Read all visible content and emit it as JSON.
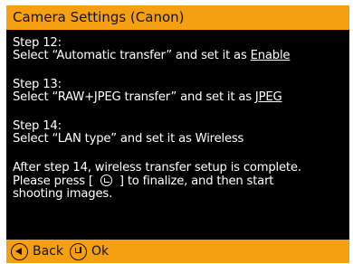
{
  "window": {
    "title": "Camera Settings (Canon)"
  },
  "steps": [
    {
      "heading": "Step 12:",
      "instruction_prefix": "Select “Automatic transfer” and set it as ",
      "value": "Enable"
    },
    {
      "heading": "Step 13:",
      "instruction_prefix": "Select “RAW+JPEG transfer” and set it as ",
      "value": "JPEG"
    },
    {
      "heading": "Step 14:",
      "instruction_prefix": "Select “LAN type” and set it as ",
      "value": "Wireless"
    }
  ],
  "final": {
    "line1": "After step 14, wireless transfer setup is complete.",
    "line2_prefix": "Please press [",
    "line2_suffix": "] to finalize, and then start",
    "line3": "shooting images.",
    "icon": "enter-icon"
  },
  "footer": {
    "back_label": "Back",
    "back_icon": "left-arrow-circle-icon",
    "ok_label": "Ok",
    "ok_icon": "enter-circle-icon"
  },
  "colors": {
    "accent": "#f5a012",
    "background": "#000000",
    "text": "#ffffff"
  }
}
